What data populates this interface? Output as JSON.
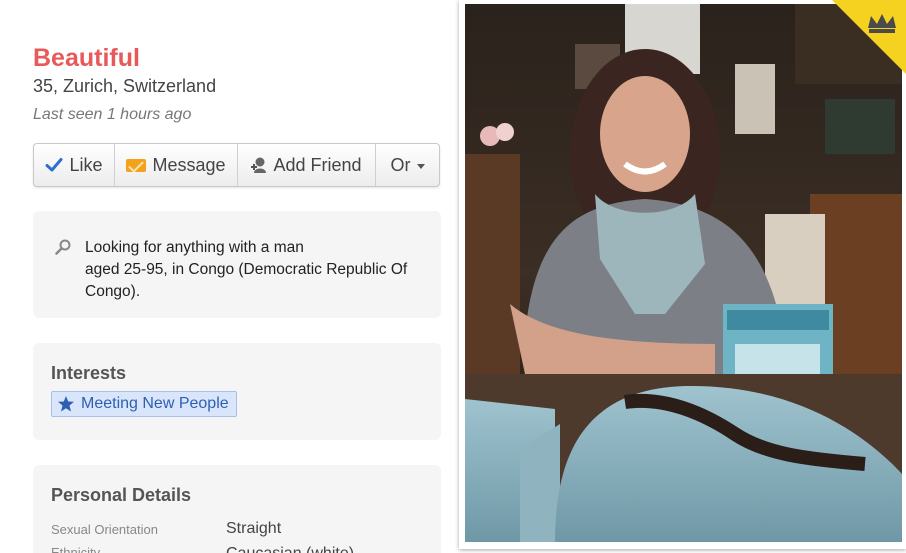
{
  "profile": {
    "name": "Beautiful",
    "meta": "35, Zurich, Switzerland",
    "last_seen": "Last seen 1 hours ago"
  },
  "actions": {
    "like": "Like",
    "message": "Message",
    "add_friend": "Add Friend",
    "or": "Or"
  },
  "looking_for": {
    "line1": "Looking for anything with a man",
    "line2": "aged 25-95, in Congo (Democratic Republic Of Congo)."
  },
  "interests": {
    "title": "Interests",
    "items": [
      "Meeting New People"
    ]
  },
  "details": {
    "title": "Personal Details",
    "rows": [
      {
        "label": "Sexual Orientation",
        "value": "Straight"
      },
      {
        "label": "Ethnicity",
        "value": "Caucasian (white)"
      }
    ]
  },
  "colors": {
    "name": "#e85a5a",
    "tag_bg": "#d8e5fb",
    "tag_text": "#2f5fb3",
    "crown_bg": "#f4d21f"
  },
  "icons": [
    "check-icon",
    "envelope-icon",
    "person-add-icon",
    "chevron-down-icon",
    "search-icon",
    "star-icon",
    "crown-icon"
  ]
}
